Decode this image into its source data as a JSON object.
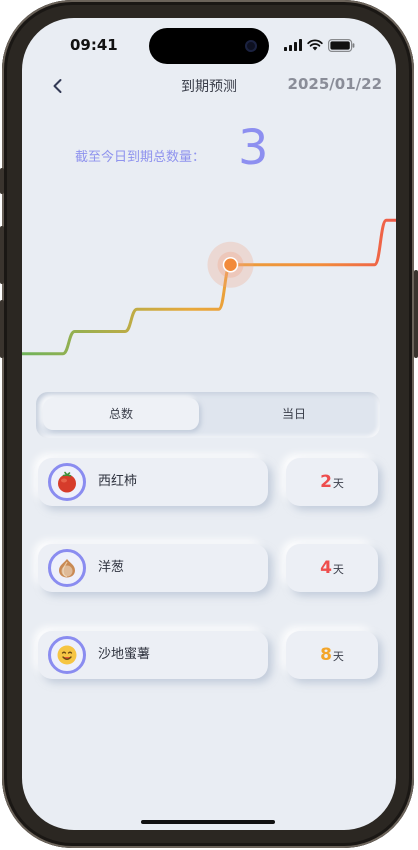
{
  "status": {
    "time": "09:41"
  },
  "nav": {
    "title": "到期预测",
    "date": "2025/01/22"
  },
  "summary": {
    "label": "截至今日到期总数量：",
    "value": "3"
  },
  "chart_data": {
    "type": "line",
    "title": "",
    "xlabel": "",
    "ylabel": "",
    "grid": false,
    "series": [
      {
        "values": [
          1,
          1,
          2,
          2,
          3,
          3,
          3,
          5,
          5,
          5,
          5,
          5,
          7
        ]
      }
    ],
    "highlight_index": 7,
    "colors": [
      "#6fb35a",
      "#e8a83a",
      "#f28c3a",
      "#ee5a4a"
    ]
  },
  "segmented": {
    "tabs": [
      "总数",
      "当日"
    ],
    "active": 0
  },
  "items": [
    {
      "name": "西红柿",
      "days": "2",
      "unit": "天",
      "color": "#ee4d4d",
      "icon": "tomato-icon"
    },
    {
      "name": "洋葱",
      "days": "4",
      "unit": "天",
      "color": "#ee4d4d",
      "icon": "onion-icon"
    },
    {
      "name": "沙地蜜薯",
      "days": "8",
      "unit": "天",
      "color": "#f3a52a",
      "icon": "sweet-potato-icon"
    }
  ]
}
